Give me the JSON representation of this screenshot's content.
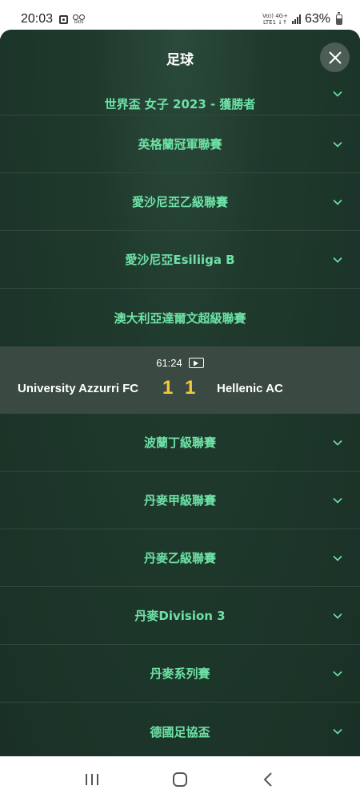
{
  "status_bar": {
    "time": "20:03",
    "oval_icon_text": "GKIS",
    "net_top": "Vo)) 4G+",
    "net_bottom": "LTE1 ↓↑",
    "battery": "63%",
    "icons": [
      "screen-record-icon",
      "oval-logo-icon",
      "signal-icon",
      "battery-icon"
    ]
  },
  "header": {
    "title": "足球",
    "close_icon": "close-icon"
  },
  "list": {
    "partial_item": "世界盃 女子 2023 - 獲勝者",
    "items": [
      "英格蘭冠軍聯賽",
      "愛沙尼亞乙級聯賽",
      "愛沙尼亞Esiliiga B",
      "澳大利亞達爾文超級聯賽"
    ],
    "items_after": [
      "波蘭丁級聯賽",
      "丹麥甲級聯賽",
      "丹麥乙級聯賽",
      "丹麥Division 3",
      "丹麥系列賽",
      "德國足協盃"
    ]
  },
  "match": {
    "time": "61:24",
    "home_team": "University Azzurri FC",
    "home_score": "1",
    "away_score": "1",
    "away_team": "Hellenic AC"
  },
  "colors": {
    "accent_green": "#6ee2a6",
    "score_yellow": "#f4c93a",
    "panel_bg": "#1f3a2d"
  },
  "nav": {
    "icons": [
      "recent-apps-icon",
      "home-icon",
      "back-icon"
    ]
  }
}
